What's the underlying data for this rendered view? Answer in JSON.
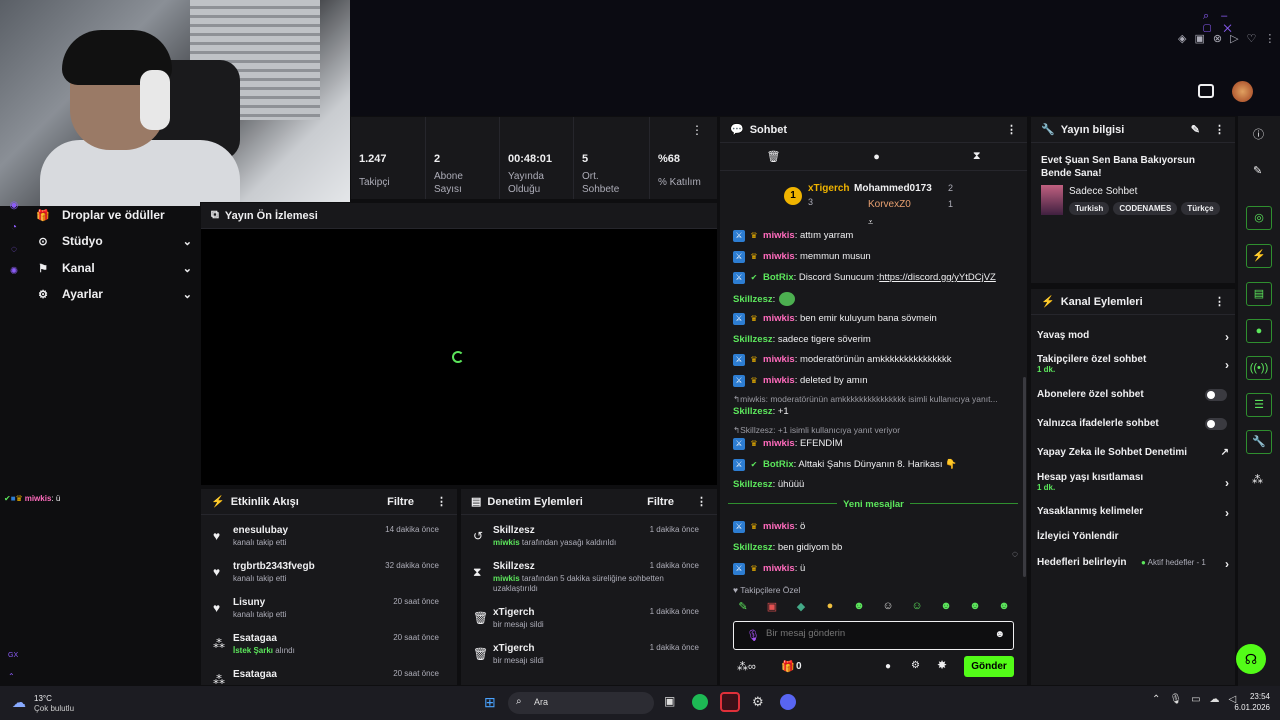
{
  "brand": {
    "accent": "#5ce65c",
    "mod_blue": "#2d7dd2",
    "pink": "#ff6bbd"
  },
  "nav": {
    "items": [
      {
        "label": "Droplar ve ödüller"
      },
      {
        "label": "Stüdyo"
      },
      {
        "label": "Kanal"
      },
      {
        "label": "Ayarlar"
      }
    ]
  },
  "overlay_chat": {
    "user": "miwkis",
    "msg": ": ü"
  },
  "stats": [
    {
      "value": "1.247",
      "label": "Takipçi"
    },
    {
      "value": "2",
      "label": "Abone Sayısı"
    },
    {
      "value": "00:48:01",
      "label": "Yayında Olduğu"
    },
    {
      "value": "5",
      "label": "Ort. Sohbete"
    },
    {
      "value": "%68",
      "label": "% Katılım"
    }
  ],
  "preview": {
    "title": "Yayın Ön İzlemesi"
  },
  "activity": {
    "title": "Etkinlik Akışı",
    "filter": "Filtre",
    "items": [
      {
        "name": "enesulubay",
        "sub": "kanalı takip etti",
        "time": "14 dakika önce"
      },
      {
        "name": "trgbrtb2343fvegb",
        "sub": "kanalı takip etti",
        "time": "32 dakika önce"
      },
      {
        "name": "Lisuny",
        "sub": "kanalı takip etti",
        "time": "20 saat önce"
      },
      {
        "name": "Esatagaa",
        "sub_hl": "İstek Şarkı",
        "sub": "alındı",
        "time": "20 saat önce"
      },
      {
        "name": "Esatagaa",
        "sub": "",
        "time": "20 saat önce"
      }
    ]
  },
  "moderation": {
    "title": "Denetim Eylemleri",
    "filter": "Filtre",
    "items": [
      {
        "name": "Skillzesz",
        "hl": "miwkis",
        "sub": "tarafından yasağı kaldırıldı",
        "time": "1 dakika önce"
      },
      {
        "name": "Skillzesz",
        "hl": "miwkis",
        "sub": "tarafından 5 dakika süreliğine sohbetten uzaklaştırıldı",
        "time": "1 dakika önce"
      },
      {
        "name": "xTigerch",
        "sub": "bir mesajı sildi",
        "time": "1 dakika önce"
      },
      {
        "name": "xTigerch",
        "sub": "bir mesajı sildi",
        "time": "1 dakika önce"
      }
    ]
  },
  "chat": {
    "title": "Sohbet",
    "top": {
      "first": "xTigerch",
      "first_count": "3",
      "second": "Mohammed0173",
      "second_count": "2",
      "third": "KorvexZ0",
      "third_count": "1",
      "rank": "1"
    },
    "lines": [
      {
        "user": "miwkis",
        "text": ": attım yarram"
      },
      {
        "user": "miwkis",
        "text": ": memmun musun"
      },
      {
        "user": "BotRix",
        "text": ": Discord Sunucum : ",
        "link": "https://discord.gg/yYtDCjVZ"
      },
      {
        "user": "Skillzesz",
        "text": ":"
      },
      {
        "user": "miwkis",
        "text": ": ben emir kuluyum bana sövmein"
      },
      {
        "user": "Skillzesz",
        "text": ": sadece tigere söverim"
      },
      {
        "user": "miwkis",
        "text": ": moderatörünün amkkkkkkkkkkkkkkk"
      },
      {
        "user": "miwkis",
        "text": ": deleted by amın"
      },
      {
        "reply": "miwkis: moderatörünün amkkkkkkkkkkkkkkk isimli kullanıcıya yanıt..."
      },
      {
        "user": "Skillzesz",
        "text": ": +1"
      },
      {
        "reply": "Skillzesz: +1 isimli kullanıcıya yanıt veriyor"
      },
      {
        "user": "miwkis",
        "text": ": EFENDİM"
      },
      {
        "user": "BotRix",
        "text": ": Alttaki Şahıs Dünyanın 8. Harikası 👇"
      },
      {
        "user": "Skillzesz",
        "text": ": ühüüü"
      }
    ],
    "new_label": "Yeni mesajlar",
    "new_lines": [
      {
        "user": "miwkis",
        "text": ": ö"
      },
      {
        "user": "Skillzesz",
        "text": ": ben gidiyom bb"
      },
      {
        "user": "miwkis",
        "text": ": ü"
      }
    ],
    "followers_only": "Takipçilere Özel",
    "input_placeholder": "Bir mesaj gönderin",
    "points": "0",
    "send": "Gönder"
  },
  "stream_info": {
    "title": "Yayın bilgisi",
    "stream_title": "Evet Şuan Sen Bana Bakıyorsun Bende Sana!",
    "category": "Sadece Sohbet",
    "tags": [
      "Turkish",
      "CODENAMES",
      "Türkçe"
    ]
  },
  "channel_actions": {
    "title": "Kanal Eylemleri",
    "items": [
      {
        "label": "Yavaş mod",
        "type": "arrow"
      },
      {
        "label": "Takipçilere özel sohbet",
        "sub": "1 dk.",
        "type": "arrow"
      },
      {
        "label": "Abonelere özel sohbet",
        "type": "toggle"
      },
      {
        "label": "Yalnızca ifadelerle sohbet",
        "type": "toggle"
      },
      {
        "label": "Yapay Zeka ile Sohbet Denetimi",
        "type": "ext"
      },
      {
        "label": "Hesap yaşı kısıtlaması",
        "sub": "1 dk.",
        "type": "arrow"
      },
      {
        "label": "Yasaklanmış kelimeler",
        "type": "arrow"
      },
      {
        "label": "İzleyici Yönlendir",
        "type": "none"
      },
      {
        "label": "Hedefleri belirleyin",
        "extra": "Aktif hedefler - 1",
        "type": "arrow"
      }
    ]
  },
  "sidebar_label": "GX",
  "taskbar": {
    "temp": "13°C",
    "weather": "Çok bulutlu",
    "search": "Ara",
    "time": "23:54",
    "date": "6.01.2026"
  }
}
